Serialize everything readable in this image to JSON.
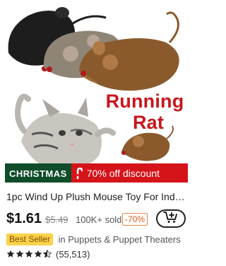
{
  "product": {
    "image": {
      "promo_line1": "Running",
      "promo_line2": "Rat"
    },
    "promo_strip": {
      "label": "CHRISTMAS",
      "discount": "70% off discount"
    },
    "title": "1pc Wind Up Plush Mouse Toy For Indo...",
    "price": "$1.61",
    "original_price": "$5.49",
    "sold": "100K+ sold",
    "discount_badge": "-70%",
    "best_seller_badge": "Best Seller",
    "category": "in Puppets & Puppet Theaters",
    "rating_value": 4.5,
    "reviews": "(55,513)"
  },
  "colors": {
    "accent_red": "#c8161d",
    "xmas_green": "#0f4d2a",
    "badge_yellow": "#fbd34b",
    "discount_orange": "#e05a1a"
  },
  "icons": {
    "cart": "add-to-cart-icon",
    "star": "star-icon"
  }
}
